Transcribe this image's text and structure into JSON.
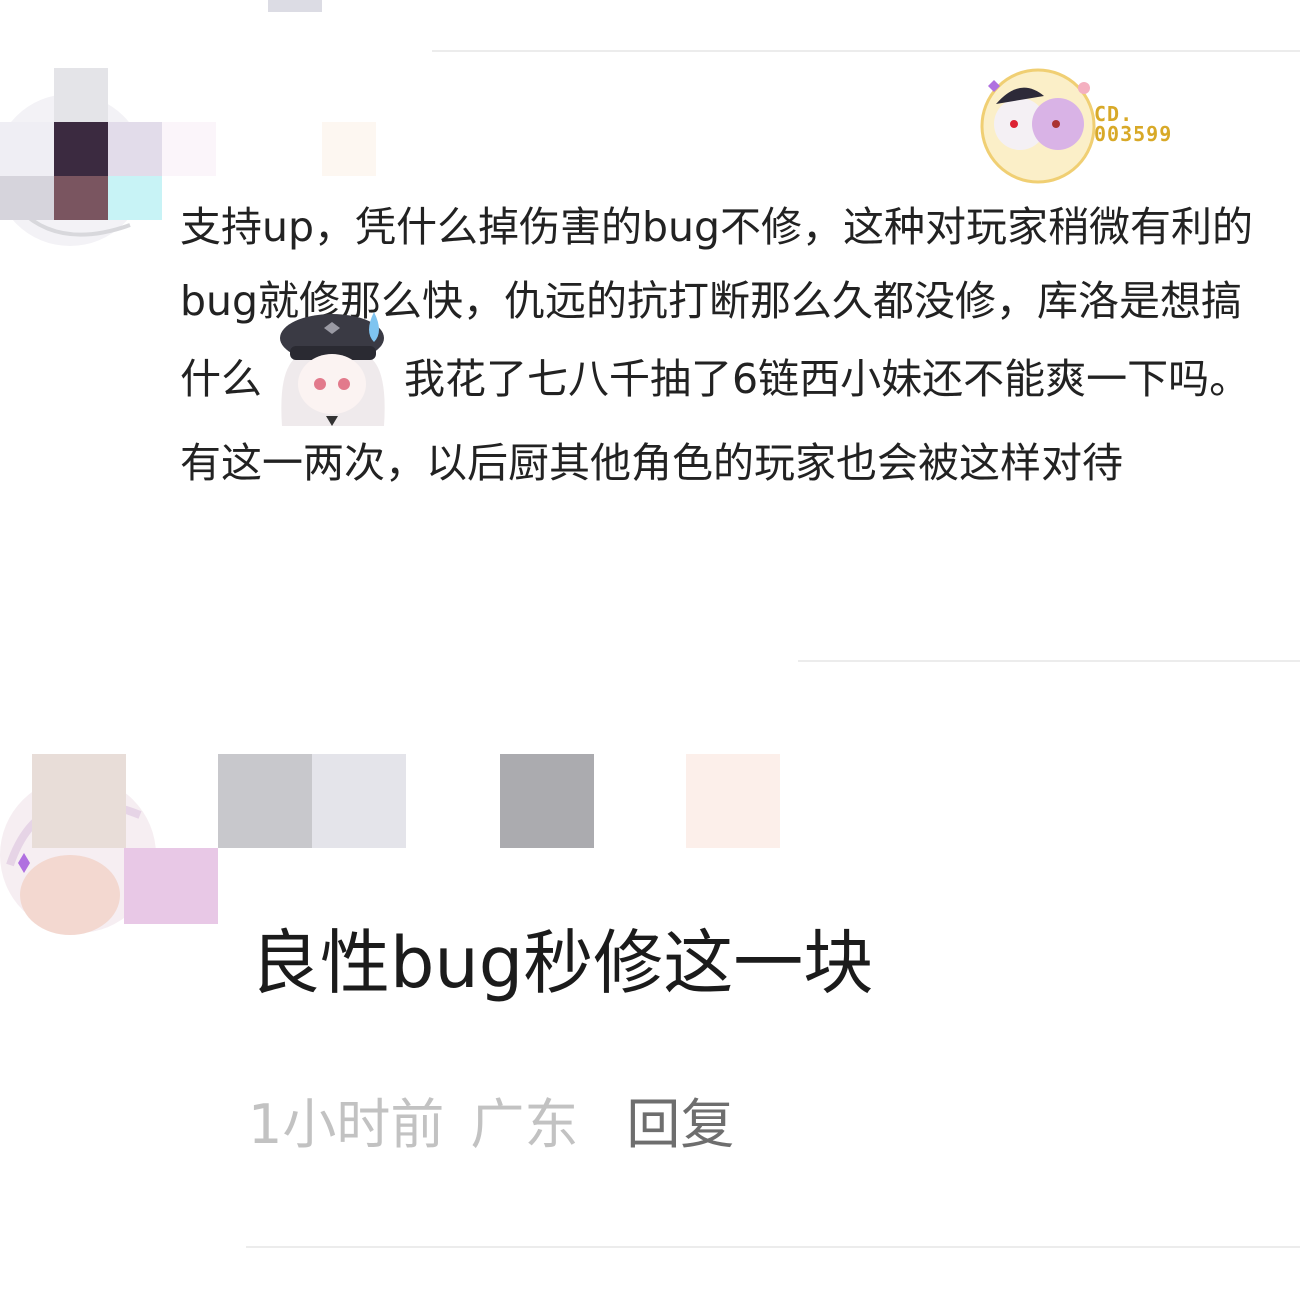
{
  "comment": {
    "badge_label": "CD.",
    "badge_number": "003599",
    "text_part1": "支持up，凭什么掉伤害的bug不修，这种对玩家稍微有利的bug就修那么快，仇远的抗打断那么久都没修，库洛是想搞什么",
    "sticker": "chibi-sweat-drop-sticker",
    "text_part2": "我花了七八千抽了6链西小妹还不能爽一下吗。有这一两次，以后厨其他角色的玩家也会被这样对待"
  },
  "reply": {
    "text": "良性bug秒修这一块",
    "time": "1小时前",
    "region": "广东",
    "reply_label": "回复"
  },
  "colors": {
    "text": "#222222",
    "meta_gray": "#c2c2c2",
    "reply_gray": "#6e6e6e",
    "badge_gold": "#d8a928"
  }
}
